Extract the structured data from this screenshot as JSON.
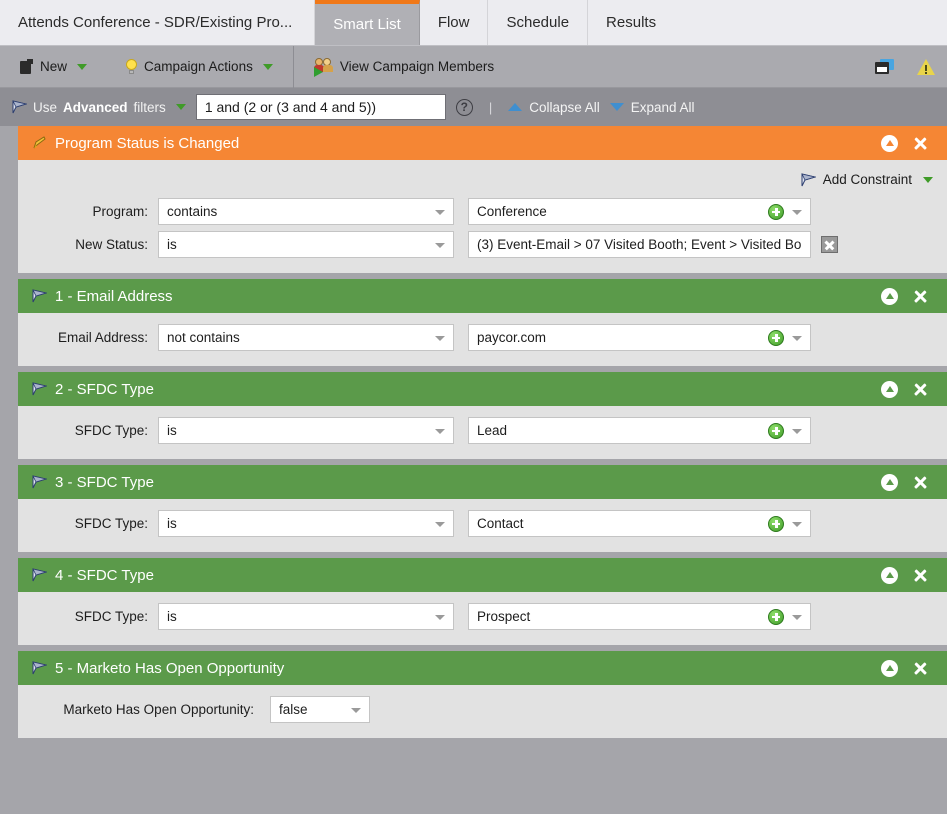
{
  "tabs": [
    {
      "label": "Attends Conference - SDR/Existing Pro...",
      "active": false,
      "kind": "title"
    },
    {
      "label": "Smart List",
      "active": true,
      "kind": "tab"
    },
    {
      "label": "Flow",
      "active": false,
      "kind": "tab"
    },
    {
      "label": "Schedule",
      "active": false,
      "kind": "tab"
    },
    {
      "label": "Results",
      "active": false,
      "kind": "tab"
    }
  ],
  "toolbar": {
    "new_label": "New",
    "new_icon": "new-document-icon",
    "campaign_actions_label": "Campaign Actions",
    "campaign_actions_icon": "lightbulb-icon",
    "view_members_label": "View Campaign Members",
    "view_members_icon": "campaign-members-icon",
    "window_icon": "window-panel-icon",
    "warning_icon": "warning-triangle-icon"
  },
  "filterbar": {
    "use_text": "Use",
    "advanced_text": "Advanced",
    "filters_text": "filters",
    "expression": "1 and (2 or (3 and 4 and 5))",
    "help_glyph": "?",
    "separator": "|",
    "collapse_all": "Collapse All",
    "expand_all": "Expand All"
  },
  "trigger_panel": {
    "title": "Program Status is Changed",
    "icon": "pencil-trigger-icon",
    "add_constraint": "Add Constraint",
    "rows": [
      {
        "label": "Program:",
        "operator": "contains",
        "value": "Conference",
        "has_plus": true,
        "has_clear": false
      },
      {
        "label": "New Status:",
        "operator": "is",
        "value": "(3) Event-Email > 07 Visited Booth; Event > Visited Bo",
        "has_plus": false,
        "has_clear": true
      }
    ]
  },
  "filters": [
    {
      "title": "1 - Email Address",
      "icon": "funnel-filter-icon",
      "row": {
        "label": "Email Address:",
        "operator": "not contains",
        "value": "paycor.com",
        "has_plus": true,
        "narrow": false
      }
    },
    {
      "title": "2 - SFDC Type",
      "icon": "funnel-filter-icon",
      "row": {
        "label": "SFDC Type:",
        "operator": "is",
        "value": "Lead",
        "has_plus": true,
        "narrow": false
      }
    },
    {
      "title": "3 - SFDC Type",
      "icon": "funnel-filter-icon",
      "row": {
        "label": "SFDC Type:",
        "operator": "is",
        "value": "Contact",
        "has_plus": true,
        "narrow": false
      }
    },
    {
      "title": "4 - SFDC Type",
      "icon": "funnel-filter-icon",
      "row": {
        "label": "SFDC Type:",
        "operator": "is",
        "value": "Prospect",
        "has_plus": true,
        "narrow": false
      }
    },
    {
      "title": "5 - Marketo Has Open Opportunity",
      "icon": "funnel-filter-icon",
      "row": {
        "label": "Marketo Has Open Opportunity:",
        "operator": "false",
        "value": "",
        "has_plus": false,
        "narrow": true
      }
    }
  ],
  "colors": {
    "trigger_orange": "#f58634",
    "filter_green": "#5b9a4a",
    "active_tab_gray": "#b0b0b5",
    "toolbar_gray": "#aaaaaf",
    "filterbar_gray": "#8e8e94",
    "panel_body": "#e2e2e2",
    "canvas_gray": "#a5a5aa",
    "accent_blue": "#3f8fd0",
    "accent_green": "#3f9b28"
  }
}
